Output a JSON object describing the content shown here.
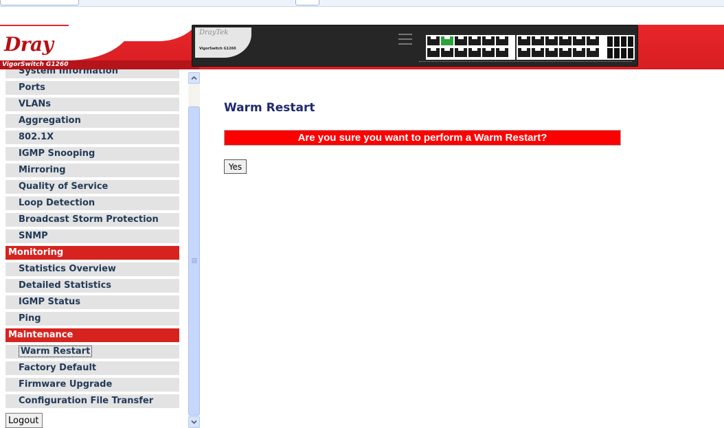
{
  "banner": {
    "logo_brand": "Dray",
    "logo_brand2": "Tek",
    "model_label": "VigorSwitch G1260",
    "panel_brand": "DrayTek",
    "panel_model": "VigorSwitch G1260"
  },
  "sidebar": {
    "items": [
      {
        "label": "System Information",
        "type": "item"
      },
      {
        "label": "Ports",
        "type": "item"
      },
      {
        "label": "VLANs",
        "type": "item"
      },
      {
        "label": "Aggregation",
        "type": "item"
      },
      {
        "label": "802.1X",
        "type": "item"
      },
      {
        "label": "IGMP Snooping",
        "type": "item"
      },
      {
        "label": "Mirroring",
        "type": "item"
      },
      {
        "label": "Quality of Service",
        "type": "item"
      },
      {
        "label": "Loop Detection",
        "type": "item"
      },
      {
        "label": "Broadcast Storm Protection",
        "type": "item"
      },
      {
        "label": "SNMP",
        "type": "item"
      },
      {
        "label": "Monitoring",
        "type": "header"
      },
      {
        "label": "Statistics Overview",
        "type": "item"
      },
      {
        "label": "Detailed Statistics",
        "type": "item"
      },
      {
        "label": "IGMP Status",
        "type": "item"
      },
      {
        "label": "Ping",
        "type": "item"
      },
      {
        "label": "Maintenance",
        "type": "header"
      },
      {
        "label": "Warm Restart",
        "type": "item",
        "selected": true
      },
      {
        "label": "Factory Default",
        "type": "item"
      },
      {
        "label": "Firmware Upgrade",
        "type": "item"
      },
      {
        "label": "Configuration File Transfer",
        "type": "item"
      }
    ],
    "logout_label": "Logout"
  },
  "main": {
    "title": "Warm Restart",
    "confirm_text": "Are you sure you want to perform a Warm Restart?",
    "yes_label": "Yes"
  },
  "colors": {
    "brand_red": "#d7231f",
    "confirm_red": "#ff0000",
    "title_navy": "#1e2a6e",
    "nav_text": "#223a58",
    "nav_bg": "#e3e3e3"
  },
  "icons": {
    "scroll_up": "chevron-up-icon",
    "scroll_down": "chevron-down-icon"
  }
}
